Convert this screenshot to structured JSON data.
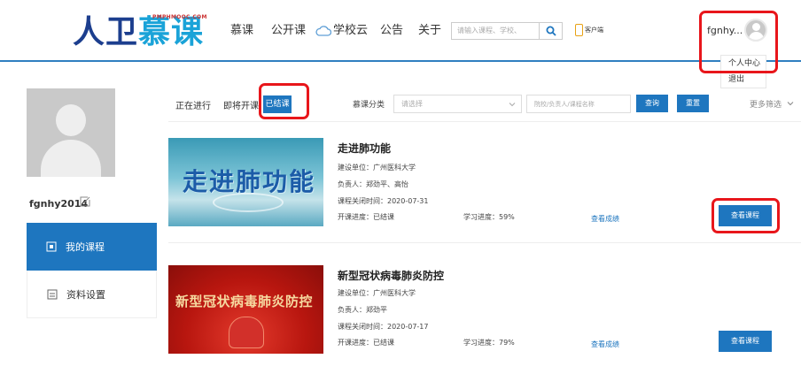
{
  "header": {
    "logo_main": "人卫",
    "logo_mu": "慕课",
    "logo_sub": "PMPHMOOC.COM",
    "nav": [
      "慕课",
      "公开课",
      "学校云",
      "公告",
      "关于"
    ],
    "search_placeholder": "请输入课程、学校、",
    "client_label": "客户端",
    "user_short": "fgnhy...",
    "dropdown": [
      "个人中心",
      "退出"
    ]
  },
  "sidebar": {
    "username": "fgnhy2014",
    "items": [
      {
        "label": "我的课程",
        "icon": "course-icon"
      },
      {
        "label": "资料设置",
        "icon": "settings-icon"
      }
    ]
  },
  "filter": {
    "tabs": [
      "正在进行",
      "即将开课",
      "已结课"
    ],
    "category_label": "慕课分类",
    "category_placeholder": "请选择",
    "keyword_placeholder": "院校/负责人/课程名称",
    "query_label": "查询",
    "reset_label": "重置",
    "more_label": "更多筛选"
  },
  "courses": [
    {
      "title": "走进肺功能",
      "thumb_text": "走进肺功能",
      "unit": "建设单位：广州医科大学",
      "lead": "负责人：郑劲平、高怡",
      "close_time": "课程关闭时间：2020-07-31",
      "status": "开课进度：已结课",
      "progress": "学习进度：59%",
      "score_link": "查看成绩",
      "view_btn": "查看课程"
    },
    {
      "title": "新型冠状病毒肺炎防控",
      "thumb_text": "新型冠状病毒肺炎防控",
      "unit": "建设单位：广州医科大学",
      "lead": "负责人：郑劲平",
      "close_time": "课程关闭时间：2020-07-17",
      "status": "开课进度：已结课",
      "progress": "学习进度：79%",
      "score_link": "查看成绩",
      "view_btn": "查看课程"
    }
  ],
  "colors": {
    "accent": "#1e76bf",
    "highlight": "#e8161b"
  }
}
